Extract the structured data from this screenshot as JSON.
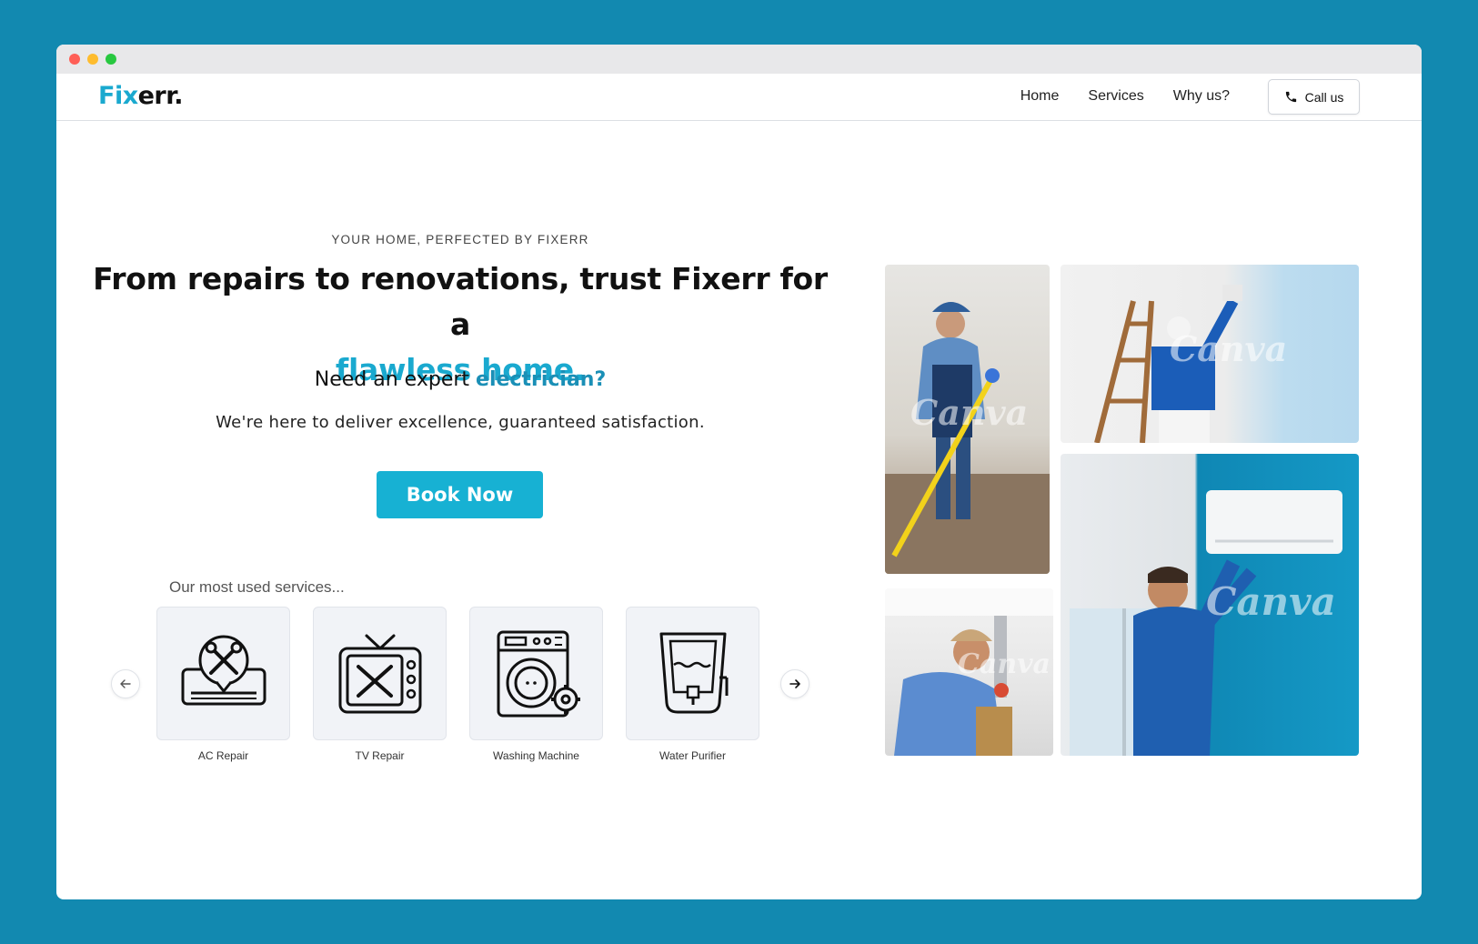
{
  "brand": {
    "accent": "Fix",
    "rest": "err.",
    "accent_color": "#1aa9cf"
  },
  "nav": {
    "links": [
      "Home",
      "Services",
      "Why us?"
    ],
    "call_label": "Call us"
  },
  "hero": {
    "eyebrow": "YOUR HOME, PERFECTED BY FIXERR",
    "headline_main": "From repairs to renovations, trust Fixerr for a",
    "headline_highlight": "flawless home.",
    "subhead_prefix": "Need an expert",
    "subhead_keyword": "electrician?",
    "tagline": "We're here to deliver excellence, guaranteed satisfaction.",
    "cta_label": "Book Now"
  },
  "services": {
    "title": "Our most used services...",
    "items": [
      {
        "label": "AC Repair",
        "icon": "ac-repair-icon"
      },
      {
        "label": "TV Repair",
        "icon": "tv-repair-icon"
      },
      {
        "label": "Washing Machine",
        "icon": "washing-machine-icon"
      },
      {
        "label": "Water Purifier",
        "icon": "water-purifier-icon"
      }
    ]
  },
  "gallery": {
    "watermark": "Canva",
    "photos": [
      {
        "name": "cleaner-mopping-photo"
      },
      {
        "name": "painter-on-ladder-photo"
      },
      {
        "name": "plumber-under-sink-photo"
      },
      {
        "name": "ac-technician-photo"
      }
    ]
  },
  "colors": {
    "page_background": "#1289b0",
    "accent": "#1aa9cf",
    "cta": "#17b1d3"
  }
}
